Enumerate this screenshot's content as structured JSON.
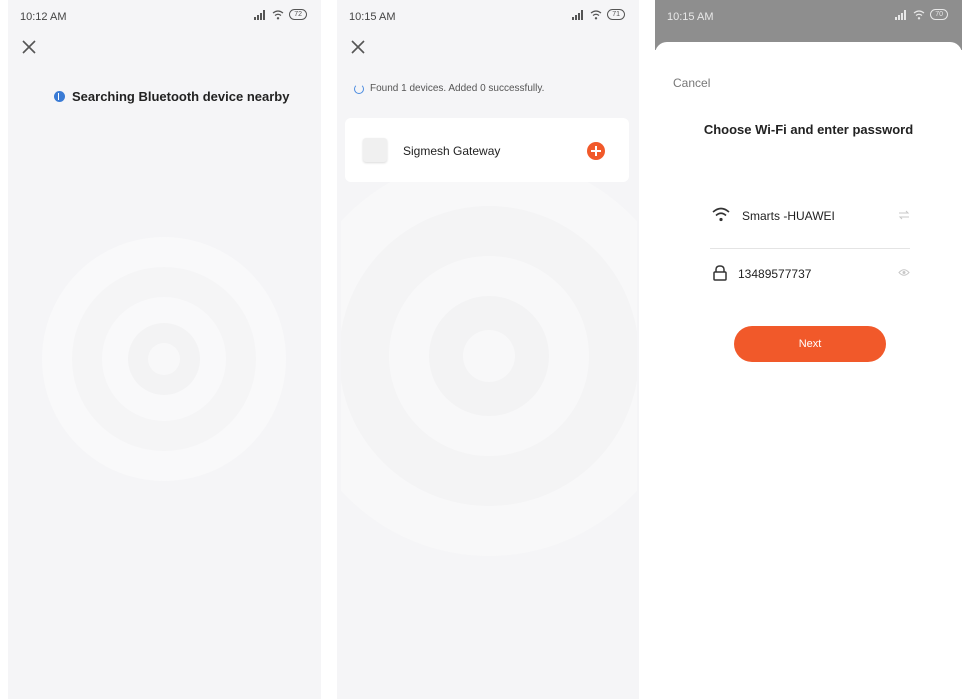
{
  "colors": {
    "accent": "#f1592a",
    "bluetooth": "#3a7bd5",
    "background": "#f5f5f7",
    "overlay": "#8e8e8e"
  },
  "screen1": {
    "status": {
      "time": "10:12 AM",
      "battery": "72"
    },
    "close_icon": "close-icon",
    "search_text": "Searching Bluetooth device nearby"
  },
  "screen2": {
    "status": {
      "time": "10:15 AM",
      "battery": "71"
    },
    "close_icon": "close-icon",
    "found_text": "Found 1 devices. Added 0 successfully.",
    "devices": [
      {
        "name": "Sigmesh Gateway"
      }
    ]
  },
  "screen3": {
    "status": {
      "time": "10:15 AM",
      "battery": "70"
    },
    "cancel_label": "Cancel",
    "title": "Choose Wi-Fi and enter password",
    "wifi_name": "Smarts -HUAWEI",
    "password": "13489577737",
    "next_label": "Next"
  }
}
